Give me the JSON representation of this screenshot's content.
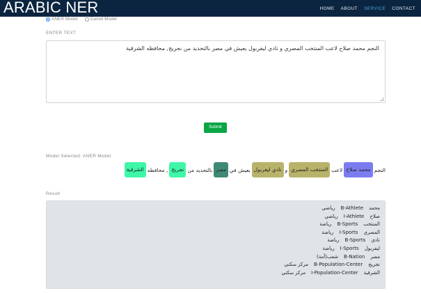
{
  "navbar": {
    "brand": "ARABIC NER",
    "links": [
      {
        "label": "HOME",
        "active": false
      },
      {
        "label": "ABOUT",
        "active": false
      },
      {
        "label": "SERVICE",
        "active": true
      },
      {
        "label": "CONTACT",
        "active": false
      }
    ]
  },
  "models": {
    "options": [
      {
        "label": "ANER Model",
        "checked": true
      },
      {
        "label": "Camel Model",
        "checked": false
      }
    ]
  },
  "input": {
    "label": "ENTER TEXT",
    "value": "النجم محمد صلاح لاعب المنتخب المصري و نادي ليفربول يعيش في مصر بالتحديد من نجريج, محافظه الشرقية"
  },
  "submit_label": "Submit",
  "model_selected": "Model Selected: ANER Model",
  "ner_output": [
    {
      "text": "النجم"
    },
    {
      "text": "محمد صلاح",
      "color": "#7b7cf0"
    },
    {
      "text": "لاعب"
    },
    {
      "text": "المنتخب المصري",
      "color": "#b8b36a"
    },
    {
      "text": "و"
    },
    {
      "text": "نادي ليفربول",
      "color": "#b8b36a"
    },
    {
      "text": "يعيش في"
    },
    {
      "text": "مصر",
      "color": "#3f8a76"
    },
    {
      "text": "بالتحديد من"
    },
    {
      "text": "نجريج",
      "color": "#3ef7a8"
    },
    {
      "text": ", محافظه"
    },
    {
      "text": "الشرقية",
      "color": "#3ef7a8"
    }
  ],
  "result": {
    "label": "Result",
    "rows": [
      {
        "word": "محمد",
        "tag": "B-Athlete",
        "category": "رياضي"
      },
      {
        "word": "صلاح",
        "tag": "I-Athlete",
        "category": "رياضي"
      },
      {
        "word": "المنتخب",
        "tag": "B-Sports",
        "category": "رياضة"
      },
      {
        "word": "المصري",
        "tag": "I-Sports",
        "category": "رياضة"
      },
      {
        "word": "نادي",
        "tag": "B-Sports",
        "category": "رياضة"
      },
      {
        "word": "ليفربول",
        "tag": "I-Sports",
        "category": "رياضة"
      },
      {
        "word": "مصر",
        "tag": "B-Nation",
        "category": "شعب(أمة)"
      },
      {
        "word": "نجريج",
        "tag": "B-Population-Center",
        "category": "مركز سكني"
      },
      {
        "word": "الشرقية",
        "tag": "I-Population-Center",
        "category": "مركز سكني"
      }
    ]
  }
}
